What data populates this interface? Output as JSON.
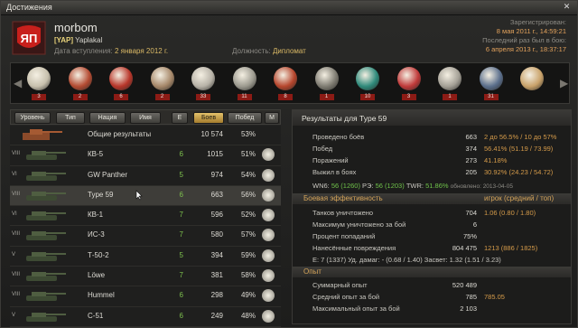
{
  "window": {
    "title": "Достижения",
    "close_glyph": "✕"
  },
  "player": {
    "name": "morbom",
    "clan_tag": "[YAP]",
    "clan_name": "Yaplakal",
    "joined_label": "Дата вступления:",
    "joined_date": "2 января 2012 г.",
    "role_label": "Должность:",
    "role": "Дипломат",
    "registered_label": "Зарегистрирован:",
    "registered": "8 мая 2011 г., 14:59:21",
    "last_battle_label": "Последний раз был в бою:",
    "last_battle": "6 апреля 2013 г., 18:37:17"
  },
  "medals": [
    {
      "icon": "warrior-medal-icon",
      "count": "3",
      "color": "#c7c0ad"
    },
    {
      "icon": "invader-medal-icon",
      "count": "2",
      "color": "#b44b32"
    },
    {
      "icon": "defender-medal-icon",
      "count": "6",
      "color": "#b8362a"
    },
    {
      "icon": "scout-medal-icon",
      "count": "2",
      "color": "#a6886a"
    },
    {
      "icon": "confederate-medal-icon",
      "count": "33",
      "color": "#b7b2a7"
    },
    {
      "icon": "tank-badge-icon",
      "count": "11",
      "color": "#9c9a8f"
    },
    {
      "icon": "steel-wall-medal-icon",
      "count": "8",
      "color": "#b6462d"
    },
    {
      "icon": "sniper-medal-icon",
      "count": "1",
      "color": "#7f7c72"
    },
    {
      "icon": "patrol-duty-medal-icon",
      "count": "10",
      "color": "#2f8a7b"
    },
    {
      "icon": "top-gun-medal-icon",
      "count": "3",
      "color": "#c03a3a"
    },
    {
      "icon": "tank-expert-medal-icon",
      "count": "1",
      "color": "#a4a096"
    },
    {
      "icon": "kolobanov-medal-icon",
      "count": "31",
      "color": "#5b6f8c"
    },
    {
      "icon": "hexagon-medal-icon",
      "count": "",
      "color": "#c9a26a"
    }
  ],
  "sort_buttons": [
    "Уровень",
    "Тип",
    "Нация",
    "Имя",
    "Е",
    "Боев",
    "Побед",
    "М"
  ],
  "vehicles": [
    {
      "level": "",
      "name": "Общие результаты",
      "mark": "",
      "battles": "10 574",
      "winrate": "53%",
      "medal": false
    },
    {
      "level": "VIII",
      "name": "КВ-5",
      "mark": "6",
      "battles": "1015",
      "winrate": "51%",
      "medal": true
    },
    {
      "level": "VI",
      "name": "GW Panther",
      "mark": "5",
      "battles": "974",
      "winrate": "54%",
      "medal": true
    },
    {
      "level": "VIII",
      "name": "Type 59",
      "mark": "6",
      "battles": "663",
      "winrate": "56%",
      "medal": true
    },
    {
      "level": "VI",
      "name": "КВ-1",
      "mark": "7",
      "battles": "596",
      "winrate": "52%",
      "medal": true
    },
    {
      "level": "VIII",
      "name": "ИС-3",
      "mark": "7",
      "battles": "580",
      "winrate": "57%",
      "medal": true
    },
    {
      "level": "V",
      "name": "Т-50-2",
      "mark": "5",
      "battles": "394",
      "winrate": "59%",
      "medal": true
    },
    {
      "level": "VIII",
      "name": "Löwe",
      "mark": "7",
      "battles": "381",
      "winrate": "58%",
      "medal": true
    },
    {
      "level": "VIII",
      "name": "Hummel",
      "mark": "6",
      "battles": "298",
      "winrate": "49%",
      "medal": true
    },
    {
      "level": "V",
      "name": "С-51",
      "mark": "6",
      "battles": "249",
      "winrate": "48%",
      "medal": true
    }
  ],
  "results": {
    "title": "Результаты для Type 59",
    "general": [
      {
        "label": "Проведено боёв",
        "value": "663",
        "extra": "2 до 56.5% / 10 до 57%"
      },
      {
        "label": "Побед",
        "value": "374",
        "extra": "56.41% (51.19 / 73.99)"
      },
      {
        "label": "Поражений",
        "value": "273",
        "extra": "41.18%"
      },
      {
        "label": "Выжил в боях",
        "value": "205",
        "extra": "30.92% (24.23 / 54.72)"
      }
    ],
    "rating_line": {
      "wn6": "WN6:",
      "wn6_v": "56 (1260)",
      "re": "РЭ:",
      "re_v": "56 (1203)",
      "twr": "TWR:",
      "twr_v": "51.86%",
      "updated": "обновлено: 2013-04-05"
    },
    "combat_header": "Боевая эффективность",
    "combat_header_right": "игрок (средний / топ)",
    "combat": [
      {
        "label": "Танков уничтожено",
        "value": "704",
        "extra": "1.06 (0.80 / 1.80)"
      },
      {
        "label": "Максимум уничтожено за бой",
        "value": "6",
        "extra": ""
      },
      {
        "label": "Процент попаданий",
        "value": "75%",
        "extra": ""
      },
      {
        "label": "Нанесённые повреждения",
        "value": "804 475",
        "extra": "1213 (886 / 1825)"
      }
    ],
    "eff_line": "Е: 7 (1337)  Уд. дамаг: - (0.68 / 1.40)  Засвет: 1.32 (1.51 / 3.23)",
    "exp_header": "Опыт",
    "exp": [
      {
        "label": "Суммарный опыт",
        "value": "520 489",
        "extra": ""
      },
      {
        "label": "Средний опыт за бой",
        "value": "785",
        "extra": "785.05"
      },
      {
        "label": "Максимальный опыт за бой",
        "value": "2 103",
        "extra": ""
      }
    ]
  },
  "colors": {
    "accent": "#d59b4a",
    "good": "#6fc24a",
    "medal_count_bg": "#8c1b15"
  }
}
